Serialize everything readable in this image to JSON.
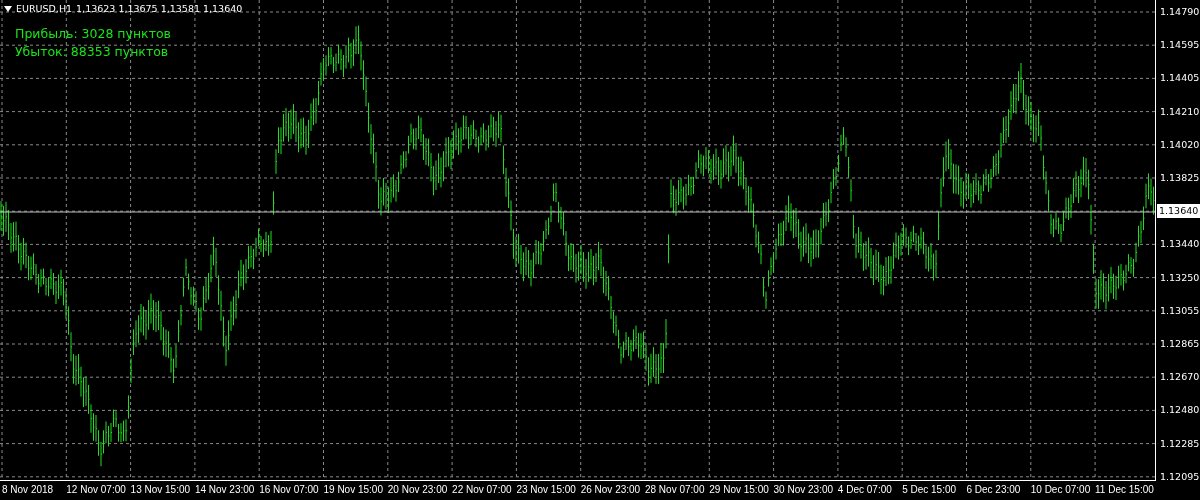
{
  "header": {
    "symbol": "EURUSD,H1",
    "quotes": "1,13623 1,13675 1,13581 1,13640"
  },
  "stats": [
    "Прибыль: 3028 пунктов",
    "Убыток: 88353 пунктов"
  ],
  "price_axis": {
    "labels": [
      "1.14790",
      "1.14595",
      "1.14405",
      "1.14210",
      "1.14020",
      "1.13825",
      "1.13440",
      "1.13250",
      "1.13055",
      "1.12865",
      "1.12670",
      "1.12480",
      "1.12285",
      "1.12095"
    ],
    "current": "1.13640"
  },
  "time_axis": [
    "8 Nov 2018",
    "12 Nov 07:00",
    "13 Nov 15:00",
    "14 Nov 23:00",
    "16 Nov 07:00",
    "19 Nov 15:00",
    "20 Nov 23:00",
    "22 Nov 07:00",
    "23 Nov 15:00",
    "26 Nov 23:00",
    "28 Nov 07:00",
    "29 Nov 15:00",
    "30 Nov 23:00",
    "4 Dec 07:00",
    "5 Dec 15:00",
    "6 Dec 23:00",
    "10 Dec 07:00",
    "11 Dec 15:00"
  ]
}
